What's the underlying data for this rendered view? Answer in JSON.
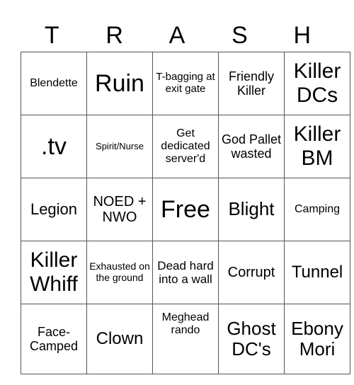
{
  "title_letters": [
    "T",
    "R",
    "A",
    "S",
    "H"
  ],
  "rows": [
    [
      "Blendette",
      "Ruin",
      "T-bagging at exit gate",
      "Friendly Killer",
      "Killer DCs"
    ],
    [
      ".tv",
      "Spirit/Nurse",
      "Get dedicated server'd",
      "God Pallet wasted",
      "Killer BM"
    ],
    [
      "Legion",
      "NOED + NWO",
      "Free",
      "Blight",
      "Camping"
    ],
    [
      "Killer Whiff",
      "Exhausted on the ground",
      "Dead hard into a wall",
      "Corrupt",
      "Tunnel"
    ],
    [
      "Face-Camped",
      "Clown",
      "Meghead rando",
      "Ghost DC's",
      "Ebony Mori"
    ]
  ],
  "free_space": {
    "row": 2,
    "col": 2,
    "label": "Free"
  },
  "colors": {
    "border": "#555555",
    "text": "#000000",
    "background": "#ffffff"
  }
}
